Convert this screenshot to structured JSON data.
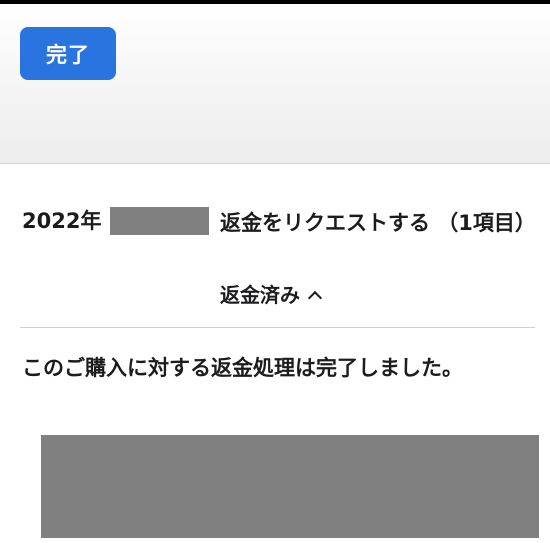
{
  "nav": {
    "done_label": "完了"
  },
  "request": {
    "order_date": "2022年",
    "title": "返金をリクエストする （1項目）",
    "status": "返金済み"
  },
  "message": {
    "text": "このご購入に対する返金処理は完了しました。"
  },
  "colors": {
    "accent": "#2a74e0",
    "redaction": "#808080"
  },
  "icons": {
    "status_toggle": "chevron-up-icon"
  }
}
